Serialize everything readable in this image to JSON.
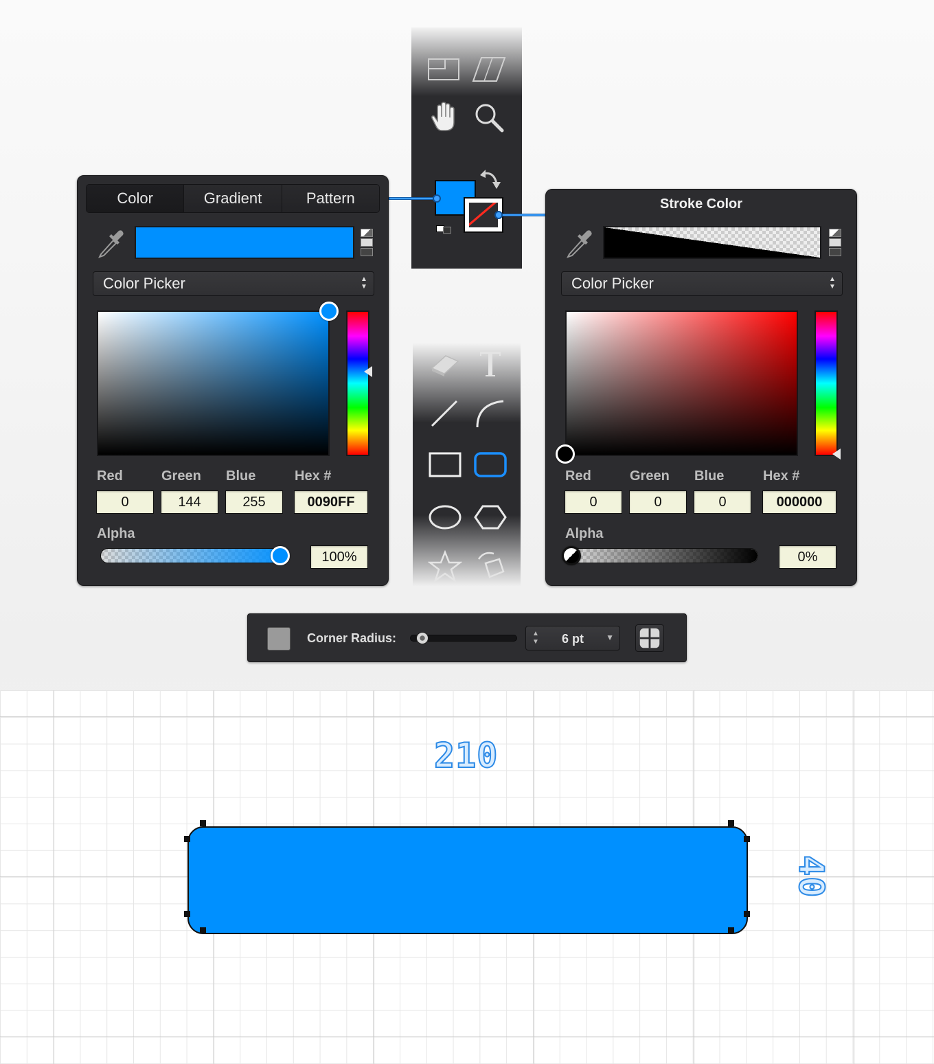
{
  "fill_panel": {
    "tabs": [
      "Color",
      "Gradient",
      "Pattern"
    ],
    "active_tab": "Color",
    "swatch_color": "#0090FF",
    "mode_select": "Color Picker",
    "fields": {
      "red_label": "Red",
      "green_label": "Green",
      "blue_label": "Blue",
      "hex_label": "Hex #",
      "red": "0",
      "green": "144",
      "blue": "255",
      "hex": "0090FF"
    },
    "alpha_label": "Alpha",
    "alpha_value": "100%",
    "alpha_fraction": 1.0,
    "hue_color": "#0090FF"
  },
  "stroke_panel": {
    "title": "Stroke Color",
    "mode_select": "Color Picker",
    "fields": {
      "red_label": "Red",
      "green_label": "Green",
      "blue_label": "Blue",
      "hex_label": "Hex #",
      "red": "0",
      "green": "0",
      "blue": "0",
      "hex": "000000"
    },
    "alpha_label": "Alpha",
    "alpha_value": "0%",
    "alpha_fraction": 0.0,
    "hue_color": "#FF0000"
  },
  "tools": {
    "top": [
      "artboard-icon",
      "skew-icon",
      "hand-icon",
      "zoom-icon"
    ],
    "bottom": [
      "eraser-icon",
      "text-icon",
      "line-icon",
      "arc-icon",
      "rectangle-icon",
      "rounded-rectangle-icon",
      "ellipse-icon",
      "polygon-icon",
      "star-icon",
      "rotate-shape-icon"
    ],
    "active": "rounded-rectangle-icon"
  },
  "corner_radius": {
    "label": "Corner Radius:",
    "value": "6 pt"
  },
  "canvas": {
    "width_label": "210",
    "height_label": "40",
    "shape_fill": "#0090FF",
    "shape_stroke": "#111111"
  }
}
